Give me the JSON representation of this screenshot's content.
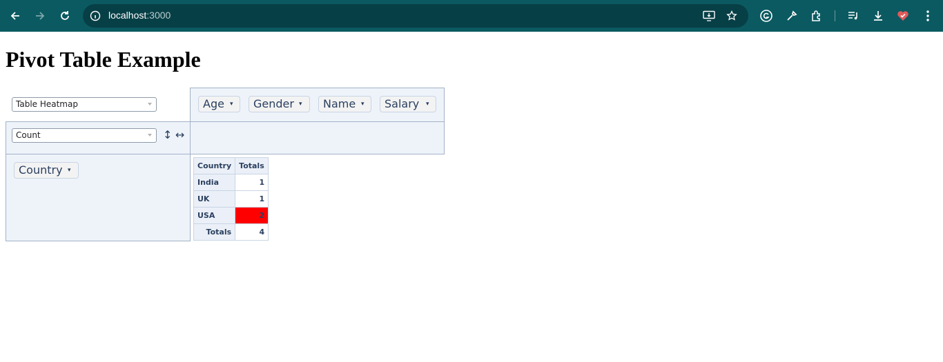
{
  "browser": {
    "url_host": "localhost",
    "url_port": ":3000"
  },
  "page": {
    "title": "Pivot Table Example"
  },
  "pivot": {
    "renderer": "Table Heatmap",
    "aggregator": "Count",
    "order_rows_symbol": "↕",
    "order_cols_symbol": "↔",
    "unused_attributes": [
      "Age",
      "Gender",
      "Name",
      "Salary"
    ],
    "row_attributes": [
      "Country"
    ],
    "dropdown_arrow": "▾"
  },
  "table": {
    "header": [
      "Country",
      "Totals"
    ],
    "rows": [
      {
        "label": "India",
        "value": "1",
        "heat_color": "#ffffff"
      },
      {
        "label": "UK",
        "value": "1",
        "heat_color": "#ffffff"
      },
      {
        "label": "USA",
        "value": "2",
        "heat_color": "#ff0000"
      }
    ],
    "totals_label": "Totals",
    "grand_total": "4"
  },
  "colors": {
    "chrome_bg": "#0b5a61",
    "omnibox_bg": "#073f46",
    "pivot_bg": "#eef3fa",
    "heat_max": "#ff0000"
  }
}
